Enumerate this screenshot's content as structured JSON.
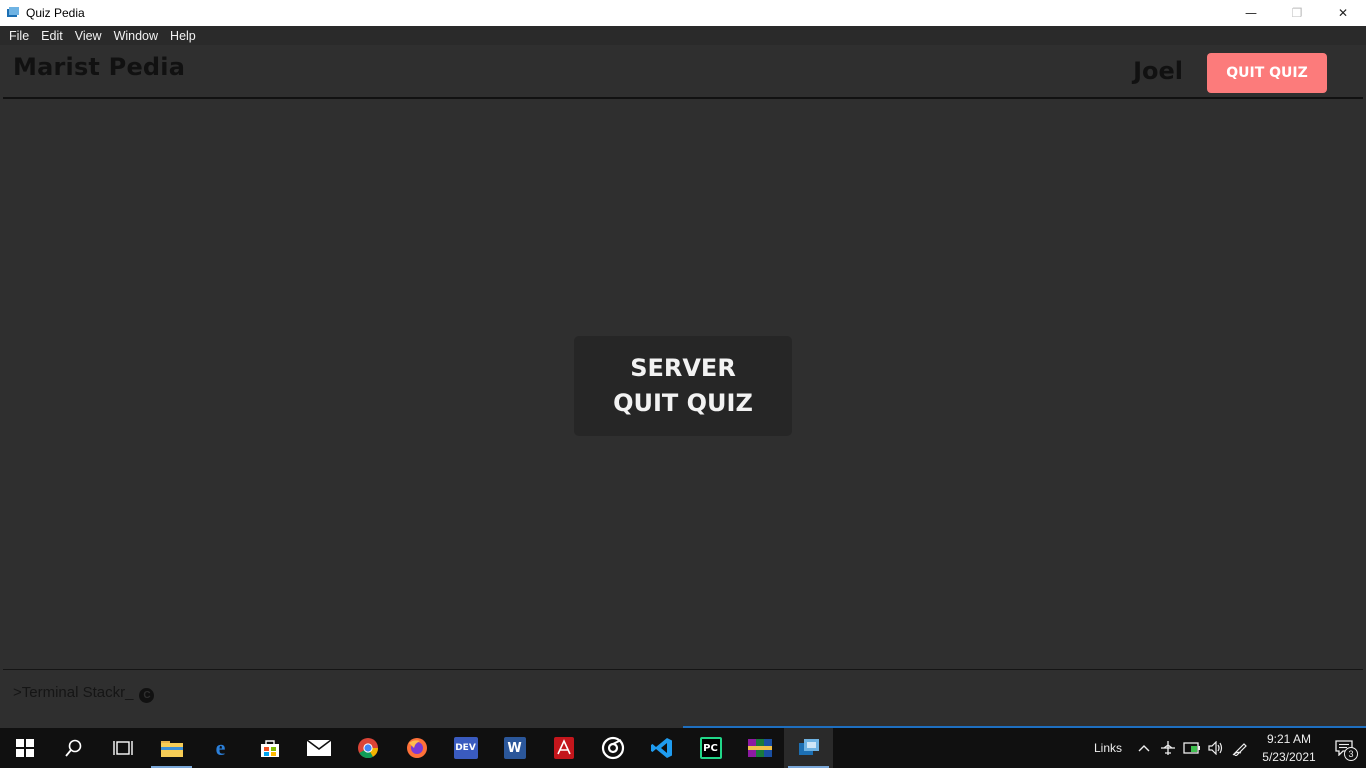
{
  "window": {
    "title": "Quiz Pedia",
    "controls": {
      "minimize": "—",
      "restore": "❐",
      "close": "✕"
    }
  },
  "menu": [
    "File",
    "Edit",
    "View",
    "Window",
    "Help"
  ],
  "app": {
    "brand": "Marist Pedia",
    "username": "Joel",
    "quit_button": "QUIT QUIZ",
    "modal_message": "SERVER QUIT QUIZ",
    "footer_text": ">Terminal Stackr_",
    "footer_icon": "copyright-icon",
    "colors": {
      "background": "#2f2f2f",
      "quit_button": "#fc7b7b",
      "modal": "#262626"
    }
  },
  "taskbar": {
    "apps": [
      {
        "name": "start",
        "icon": "windows-logo-icon"
      },
      {
        "name": "search",
        "icon": "search-icon"
      },
      {
        "name": "task-view",
        "icon": "task-view-icon"
      },
      {
        "name": "file-explorer",
        "icon": "folder-icon"
      },
      {
        "name": "edge",
        "icon": "edge-icon"
      },
      {
        "name": "store",
        "icon": "store-icon"
      },
      {
        "name": "mail",
        "icon": "mail-icon"
      },
      {
        "name": "chrome",
        "icon": "chrome-icon"
      },
      {
        "name": "firefox",
        "icon": "firefox-icon"
      },
      {
        "name": "devcpp",
        "icon": "dev-icon",
        "label": "DEV"
      },
      {
        "name": "word",
        "icon": "word-icon",
        "label": "W"
      },
      {
        "name": "acrobat",
        "icon": "acrobat-icon"
      },
      {
        "name": "groove",
        "icon": "groove-icon"
      },
      {
        "name": "vscode",
        "icon": "vscode-icon"
      },
      {
        "name": "pycharm",
        "icon": "pycharm-icon",
        "label": "PC"
      },
      {
        "name": "winrar",
        "icon": "winrar-icon"
      },
      {
        "name": "quiz-pedia",
        "icon": "quiz-pedia-icon"
      }
    ],
    "tray": {
      "links_label": "Links",
      "time": "9:21 AM",
      "date": "5/23/2021",
      "notification_count": "3"
    }
  }
}
